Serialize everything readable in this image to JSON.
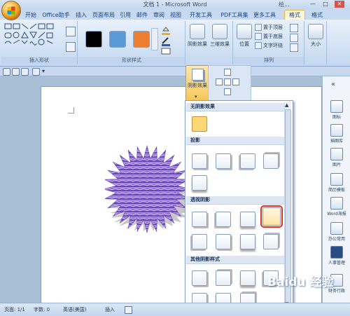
{
  "window": {
    "title": "文档 1 - Microsoft Word",
    "title_extra": "绘...",
    "buttons": [
      "—",
      "□",
      "✕"
    ]
  },
  "tabs": [
    {
      "label": "开始"
    },
    {
      "label": "Office助手"
    },
    {
      "label": "插入"
    },
    {
      "label": "页面布局"
    },
    {
      "label": "引用"
    },
    {
      "label": "邮件"
    },
    {
      "label": "审阅"
    },
    {
      "label": "视图"
    },
    {
      "label": "开发工具"
    },
    {
      "label": "PDF工具集"
    },
    {
      "label": "更多工具"
    },
    {
      "label": "格式",
      "active": true
    },
    {
      "label": "格式"
    }
  ],
  "ribbon": {
    "group_insert_shape": "插入形状",
    "group_shape_style": "形状样式",
    "group_arrange": "排列",
    "swatch_colors": [
      "#000000",
      "#5b9bd5",
      "#ed7d31"
    ],
    "shadow_label": "阴影效果",
    "threed_label": "三维效果",
    "position_label": "位置",
    "bring_front": "置于顶层",
    "send_back": "置于底层",
    "text_wrap": "文字环绕",
    "size_label": "大小"
  },
  "dropdown": {
    "button_label": "阴影效果",
    "sections": [
      "无阴影效果",
      "投影",
      "透视阴影",
      "其他阴影样式"
    ]
  },
  "right_panel": [
    {
      "label": "图标"
    },
    {
      "label": "插图库"
    },
    {
      "label": "图片"
    },
    {
      "label": "简历模板"
    },
    {
      "label": "Word海报"
    },
    {
      "label": "办公常用"
    },
    {
      "label": "人事管理"
    },
    {
      "label": "财务行政"
    }
  ],
  "status": {
    "page": "页面: 1/1",
    "words": "字数: 0",
    "lang": "英语(美国)",
    "mode": "插入"
  },
  "watermark": "Baidu 经验"
}
